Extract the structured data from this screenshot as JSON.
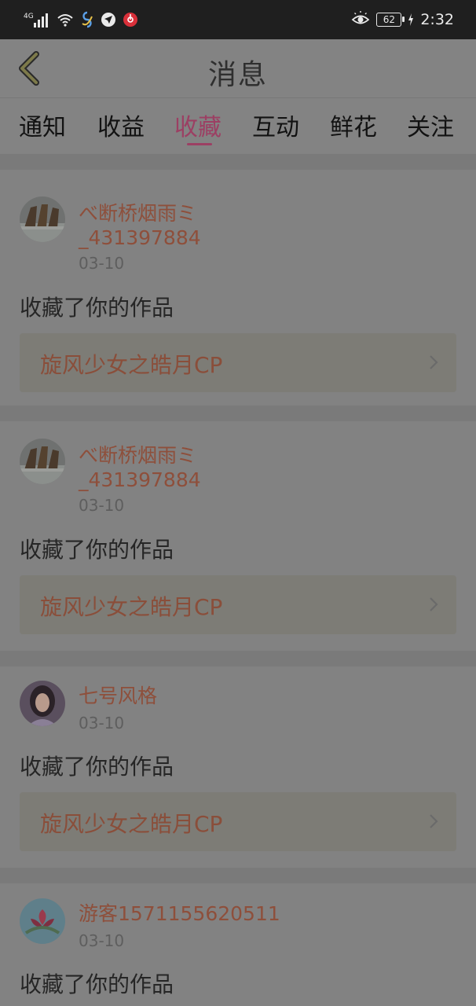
{
  "status_bar": {
    "network": "4G",
    "battery": "62",
    "time": "2:32"
  },
  "header": {
    "title": "消息"
  },
  "tabs": [
    {
      "label": "通知",
      "active": false
    },
    {
      "label": "收益",
      "active": false
    },
    {
      "label": "收藏",
      "active": true
    },
    {
      "label": "互动",
      "active": false
    },
    {
      "label": "鲜花",
      "active": false
    },
    {
      "label": "关注",
      "active": false
    }
  ],
  "messages": [
    {
      "user_line1": "べ断桥烟雨ミ",
      "user_line2": "_431397884",
      "date": "03-10",
      "action": "收藏了你的作品",
      "work": "旋风少女之皓月CP"
    },
    {
      "user_line1": "べ断桥烟雨ミ",
      "user_line2": "_431397884",
      "date": "03-10",
      "action": "收藏了你的作品",
      "work": "旋风少女之皓月CP"
    },
    {
      "user_line1": "七号风格",
      "date": "03-10",
      "action": "收藏了你的作品",
      "work": "旋风少女之皓月CP"
    },
    {
      "user_line1": "游客1571155620511",
      "date": "03-10",
      "action": "收藏了你的作品"
    }
  ],
  "colors": {
    "accent": "#9c3f63",
    "username": "#8e4f3b",
    "overlay_bg": "#828282"
  }
}
